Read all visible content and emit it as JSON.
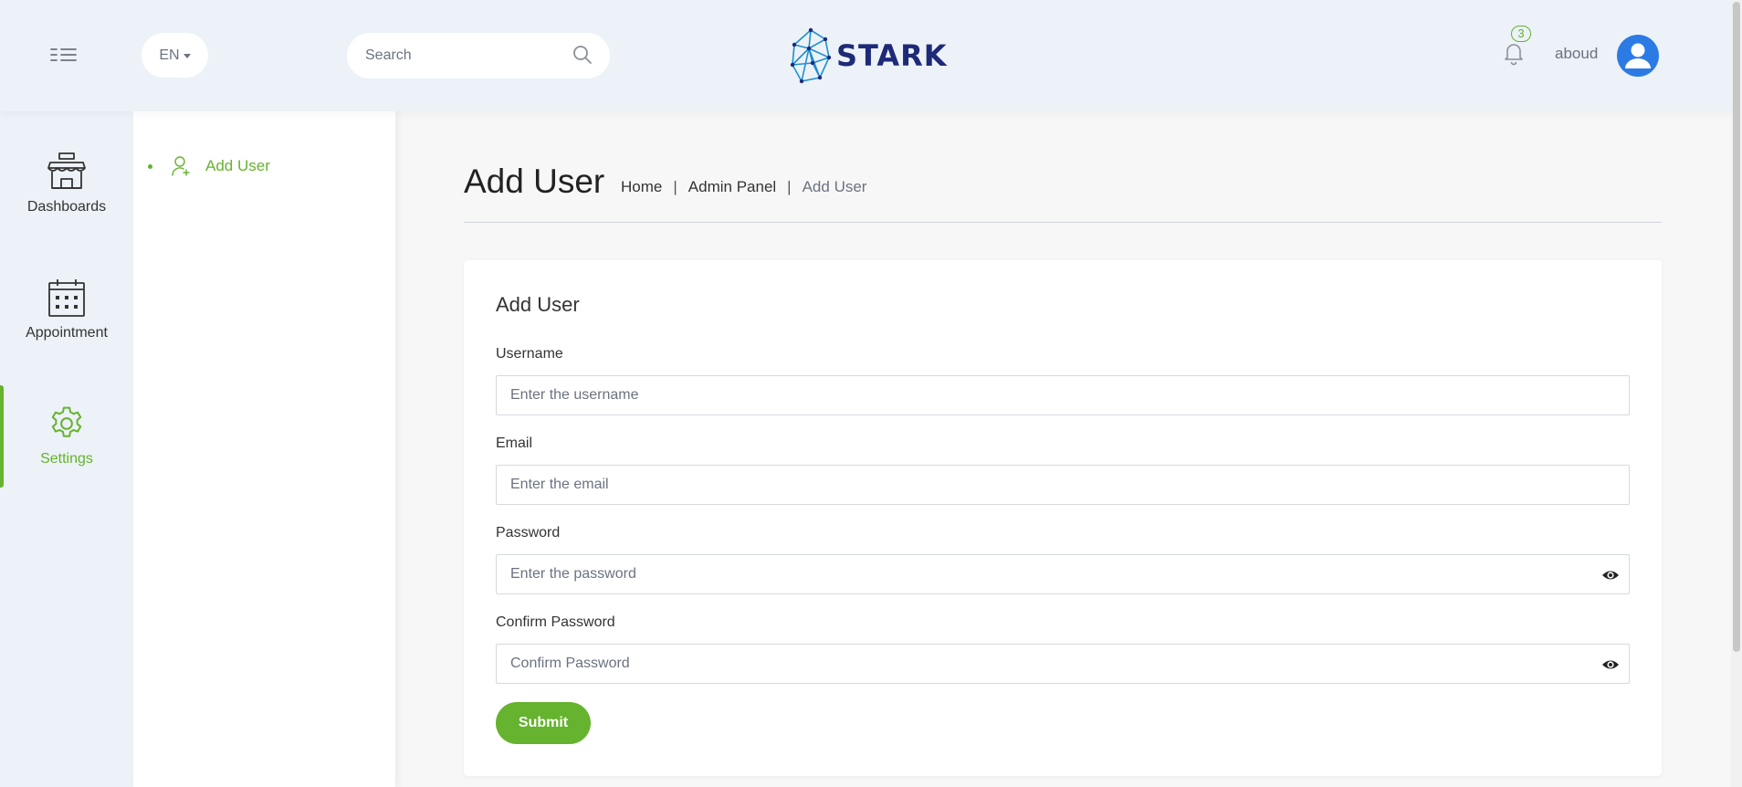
{
  "header": {
    "language": "EN",
    "search_placeholder": "Search",
    "brand": "STARK",
    "notification_count": "3",
    "user_name": "aboud"
  },
  "rail": {
    "items": [
      {
        "label": "Dashboards",
        "icon": "shop-icon",
        "active": false
      },
      {
        "label": "Appointment",
        "icon": "calendar-icon",
        "active": false
      },
      {
        "label": "Settings",
        "icon": "gear-icon",
        "active": true
      }
    ]
  },
  "submenu": {
    "items": [
      {
        "label": "Add User",
        "icon": "add-user-icon"
      }
    ]
  },
  "page": {
    "title": "Add User",
    "breadcrumb": [
      "Home",
      "Admin Panel",
      "Add User"
    ],
    "separator": "|"
  },
  "form": {
    "title": "Add User",
    "fields": [
      {
        "label": "Username",
        "placeholder": "Enter the username",
        "value": ""
      },
      {
        "label": "Email",
        "placeholder": "Enter the email",
        "value": ""
      },
      {
        "label": "Password",
        "placeholder": "Enter the password",
        "value": ""
      },
      {
        "label": "Confirm Password",
        "placeholder": "Confirm Password",
        "value": ""
      }
    ],
    "submit_label": "Submit"
  },
  "colors": {
    "accent": "#65b32e",
    "header_bg": "#ecf2f7",
    "brand_text": "#1e2a78",
    "avatar_bg": "#2c7be5"
  }
}
